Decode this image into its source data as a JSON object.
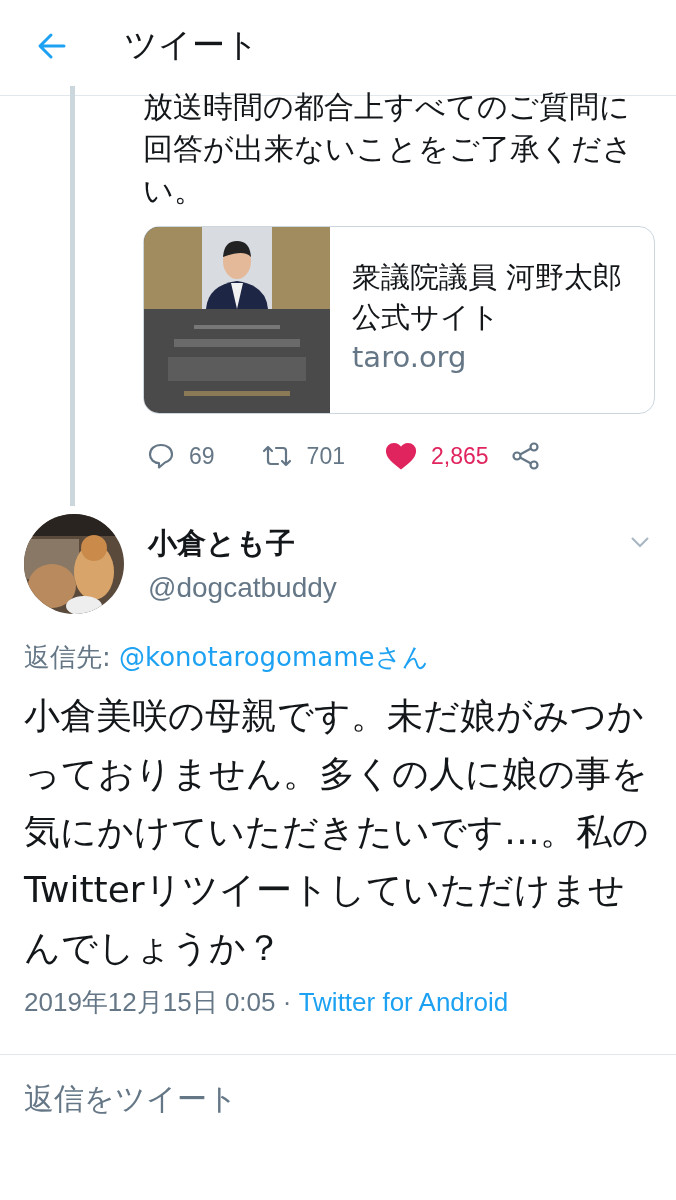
{
  "header": {
    "title": "ツイート"
  },
  "quoted_tweet": {
    "text": "放送時間の都合上すべてのご質問に回答が出来ないことをご了承ください。",
    "link_card": {
      "title": "衆議院議員 河野太郎公式サイト",
      "domain": "taro.org"
    },
    "actions": {
      "replies": "69",
      "retweets": "701",
      "likes": "2,865",
      "liked": true
    }
  },
  "tweet": {
    "author": {
      "name": "小倉とも子",
      "handle": "@dogcatbuddy"
    },
    "reply_to_label": "返信先: ",
    "reply_to": "@konotarogomameさん",
    "text": "小倉美咲の母親です。未だ娘がみつかっておりません。多くの人に娘の事を気にかけていただきたいです…。私のTwitterリツイートしていただけませんでしょうか？",
    "timestamp": "2019年12月15日 0:05 · ",
    "source": "Twitter for Android"
  },
  "reply_box": {
    "placeholder": "返信をツイート"
  }
}
